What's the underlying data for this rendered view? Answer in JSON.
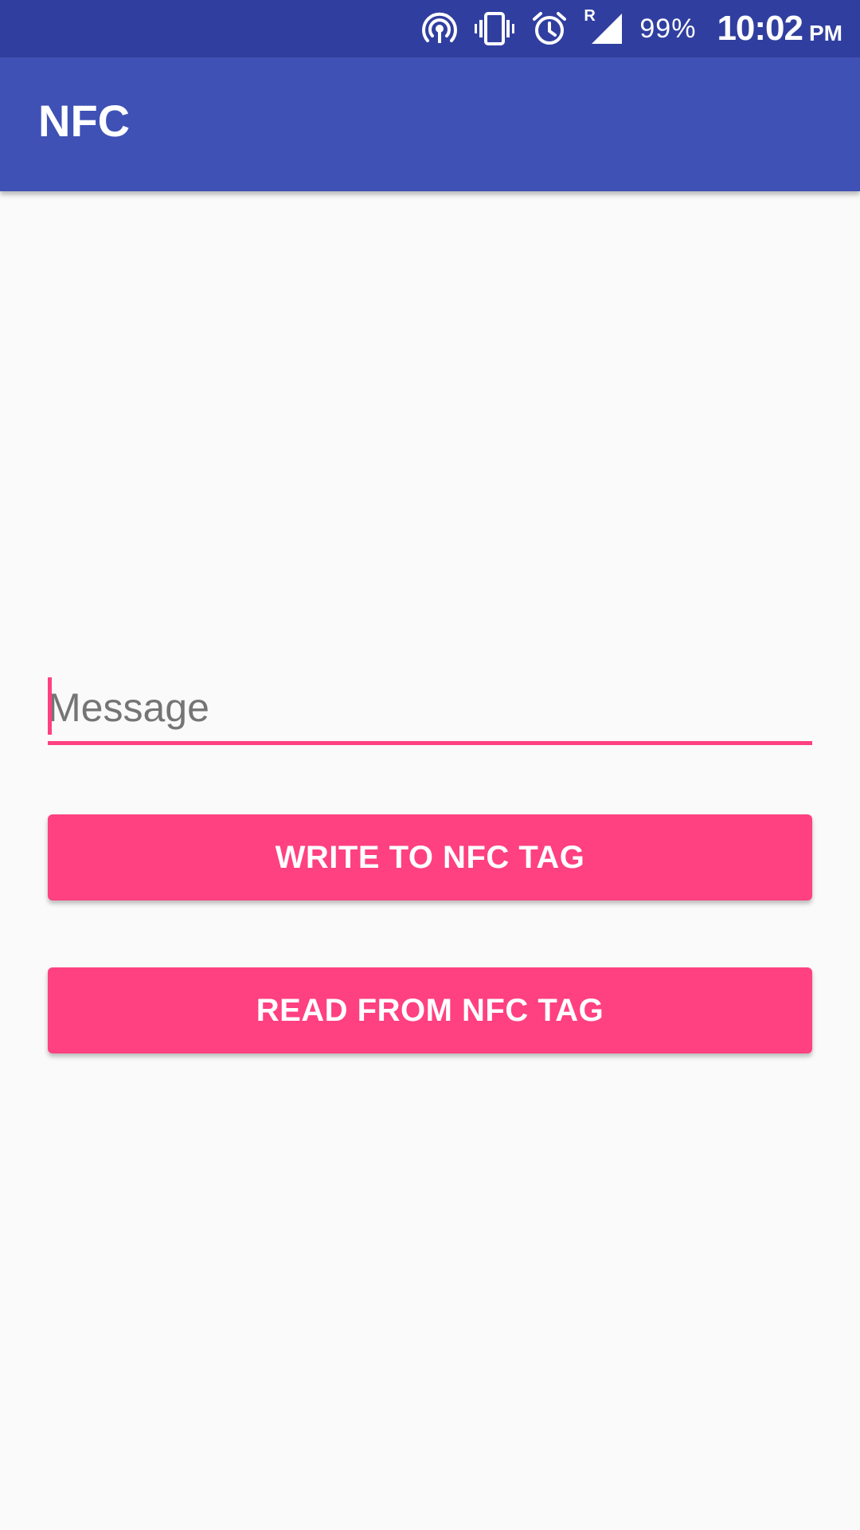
{
  "status_bar": {
    "icons": [
      "hotspot-icon",
      "vibrate-icon",
      "alarm-icon",
      "signal-roaming-icon"
    ],
    "roaming_indicator": "R",
    "battery": "99%",
    "time": "10:02",
    "ampm": "PM"
  },
  "app_bar": {
    "title": "NFC"
  },
  "form": {
    "message_placeholder": "Message",
    "message_value": "",
    "write_button_label": "WRITE TO NFC TAG",
    "read_button_label": "READ FROM NFC TAG"
  },
  "colors": {
    "status_bar": "#303f9f",
    "primary": "#3f51b5",
    "accent": "#ff4081",
    "background": "#fafafa",
    "placeholder_text": "#757575"
  }
}
